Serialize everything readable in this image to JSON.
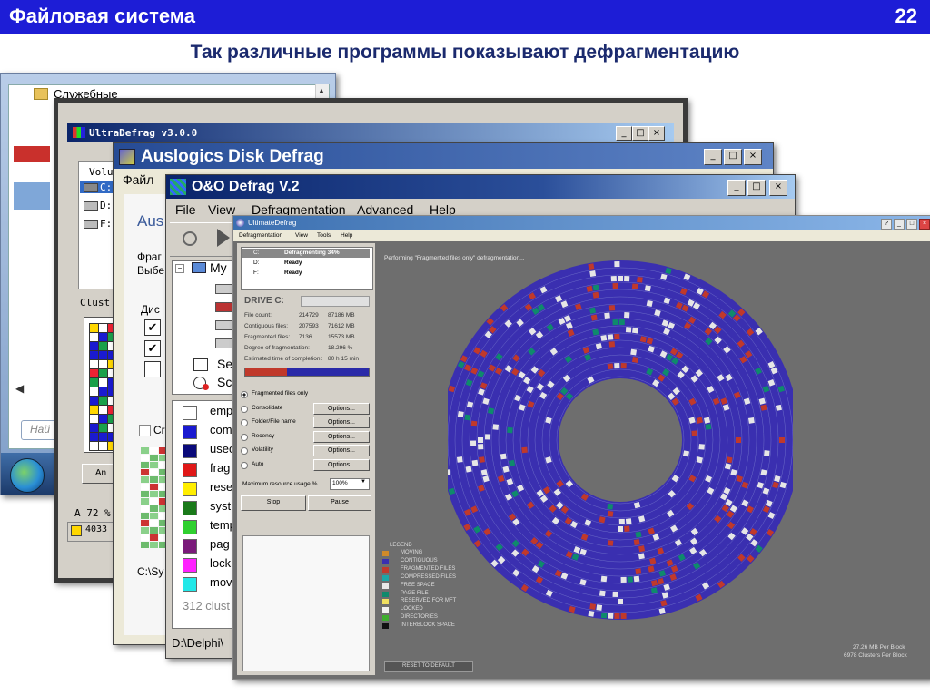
{
  "slide": {
    "title": "Файловая система",
    "number": "22",
    "subtitle": "Так различные программы показывают дефрагментацию"
  },
  "win7": {
    "folder": "Служебные",
    "search_placeholder": "Най"
  },
  "ultradefrag": {
    "title": "UltraDefrag v3.0.0",
    "vol_header": "Volu",
    "drives": [
      "C:",
      "D:",
      "F:"
    ],
    "cluster_label": "Clust",
    "analyze_btn": "An",
    "percent": "A 72 %",
    "status": "4033"
  },
  "auslogics": {
    "title": "Auslogics Disk Defrag",
    "menu": "Файл",
    "heading": "Aus",
    "text1": "Фраг",
    "text2": "Выбе",
    "disk_col": "Дис",
    "check_label": "Cr",
    "path": "C:\\Sy"
  },
  "oo": {
    "title": "O&O Defrag V.2",
    "menu": [
      "File",
      "View",
      "Defragmentation",
      "Advanced",
      "Help"
    ],
    "tree_root": "My",
    "tree_items": [
      "Se",
      "Sc"
    ],
    "legend": [
      "emp",
      "com",
      "usec",
      "frag",
      "rese",
      "syst",
      "temp",
      "pag",
      "lock",
      "mov"
    ],
    "clusters": "312 clust",
    "path": "D:\\Delphi\\"
  },
  "ultimate": {
    "title": "UltimateDefrag",
    "menu": [
      "Defragmentation",
      "View",
      "Tools",
      "Help"
    ],
    "drives": [
      {
        "letter": "C:",
        "status": "Defragmenting 34%"
      },
      {
        "letter": "D:",
        "status": "Ready"
      },
      {
        "letter": "F:",
        "status": "Ready"
      }
    ],
    "drive_label": "DRIVE C:",
    "stats": [
      {
        "label": "File count:",
        "v1": "214729",
        "v2": "87186 MB"
      },
      {
        "label": "Contiguous files:",
        "v1": "207593",
        "v2": "71612 MB"
      },
      {
        "label": "Fragmented files:",
        "v1": "7136",
        "v2": "15573 MB"
      },
      {
        "label": "Degree of fragmentation:",
        "v1": "",
        "v2": "18.296 %"
      },
      {
        "label": "Estimated time of completion:",
        "v1": "",
        "v2": "80 h 15 min"
      }
    ],
    "progress": 0.34,
    "options": [
      {
        "label": "Fragmented files only",
        "btn": ""
      },
      {
        "label": "Consolidate",
        "btn": "Options..."
      },
      {
        "label": "Folder/File name",
        "btn": "Options..."
      },
      {
        "label": "Recency",
        "btn": "Options..."
      },
      {
        "label": "Volatility",
        "btn": "Options..."
      },
      {
        "label": "Auto",
        "btn": "Options..."
      }
    ],
    "resource_label": "Maximum resource usage %",
    "resource_value": "100%",
    "stop": "Stop",
    "pause": "Pause",
    "message": "Performing \"Fragmented files only\" defragmentation...",
    "legend_title": "LEGEND",
    "legend": [
      {
        "label": "MOVING",
        "color": "#d08a2a"
      },
      {
        "label": "CONTIGUOUS",
        "color": "#3a2fb0"
      },
      {
        "label": "FRAGMENTED FILES",
        "color": "#c0392b"
      },
      {
        "label": "COMPRESSED FILES",
        "color": "#1aa6a6"
      },
      {
        "label": "FREE SPACE",
        "color": "#e8e8e8"
      },
      {
        "label": "PAGE FILE",
        "color": "#0f8a6c"
      },
      {
        "label": "RESERVED FOR MFT",
        "color": "#f0e060"
      },
      {
        "label": "LOCKED",
        "color": "#f2f2f2"
      },
      {
        "label": "DIRECTORIES",
        "color": "#3fae2f"
      },
      {
        "label": "INTERBLOCK SPACE",
        "color": "#111111"
      }
    ],
    "reset": "RESET TO DEFAULT",
    "per_block1": "27.26 MB Per Block",
    "per_block2": "6978 Clusters Per Block"
  }
}
